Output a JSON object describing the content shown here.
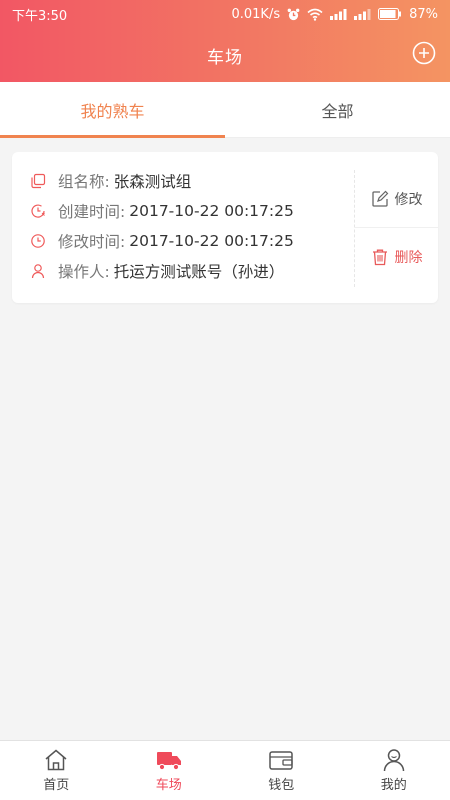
{
  "status_bar": {
    "time": "下午3:50",
    "network_speed": "0.01K/s",
    "battery": "87%",
    "icons": [
      "alarm-icon",
      "wifi-icon",
      "signal-icon",
      "signal-icon",
      "battery-icon"
    ]
  },
  "header": {
    "title": "车场",
    "add_icon": "plus-circle-icon"
  },
  "tabs": [
    {
      "label": "我的熟车",
      "active": true
    },
    {
      "label": "全部",
      "active": false
    }
  ],
  "card": {
    "rows": [
      {
        "icon": "copy-icon",
        "label": "组名称:",
        "value": "张森测试组"
      },
      {
        "icon": "clock-refresh-icon",
        "label": "创建时间:",
        "value": "2017-10-22 00:17:25"
      },
      {
        "icon": "clock-icon",
        "label": "修改时间:",
        "value": "2017-10-22 00:17:25"
      },
      {
        "icon": "person-icon",
        "label": "操作人:",
        "value": "托运方测试账号（孙进）"
      }
    ],
    "actions": {
      "edit": {
        "label": "修改",
        "icon": "edit-icon"
      },
      "delete": {
        "label": "删除",
        "icon": "trash-icon"
      }
    }
  },
  "bottom_nav": [
    {
      "label": "首页",
      "icon": "home-icon",
      "active": false
    },
    {
      "label": "车场",
      "icon": "truck-icon",
      "active": true
    },
    {
      "label": "钱包",
      "icon": "wallet-icon",
      "active": false
    },
    {
      "label": "我的",
      "icon": "user-icon",
      "active": false
    }
  ],
  "colors": {
    "accent": "#f0834f",
    "nav_active": "#ef4a5a",
    "delete": "#e85a5a",
    "header_start": "#f25764",
    "header_end": "#f49462"
  }
}
